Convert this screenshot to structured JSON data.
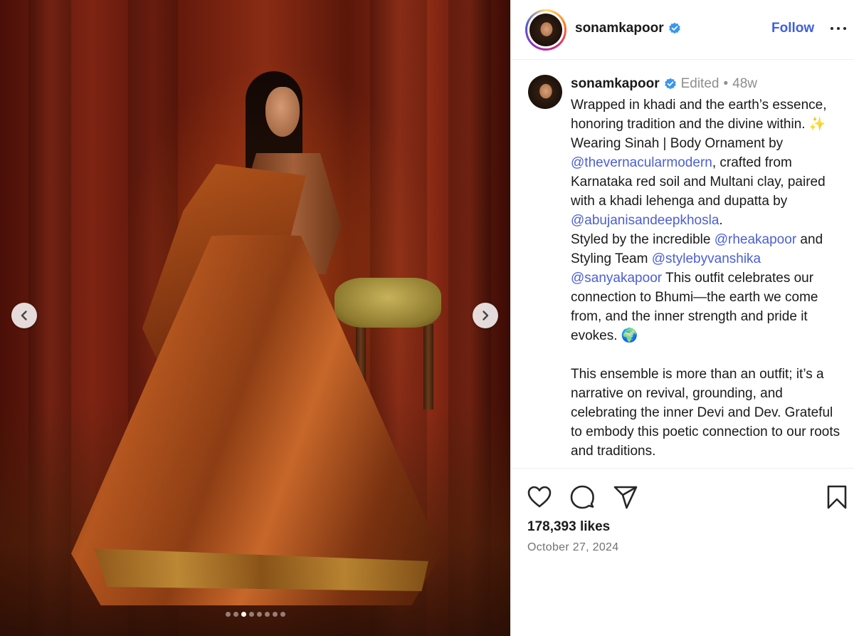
{
  "post": {
    "username": "sonamkapoor",
    "follow_label": "Follow",
    "meta_edited": "Edited",
    "meta_separator": "•",
    "meta_age": "48w",
    "caption": {
      "line1": "Wrapped in khadi and the earth’s essence, honoring tradition and the divine within. ✨",
      "l2_pre": "Wearing Sinah | Body Ornament by ",
      "mention1": "@thevernacularmodern",
      "l2_mid": ", crafted from Karnataka red soil and Multani clay, paired with a khadi lehenga and dupatta by ",
      "mention2": "@abujanisandeepkhosla",
      "l2_post": ".",
      "l3_pre": "Styled by the incredible ",
      "mention3": "@rheakapoor",
      "l3_mid": " and Styling Team ",
      "mention4": "@stylebyvanshika",
      "l3_space": " ",
      "mention5": "@sanyakapoor",
      "l3_post": " This outfit celebrates our connection to Bhumi—the earth we come from, and the inner strength and pride it evokes. 🌍",
      "para2": "This ensemble is more than an outfit; it’s a narrative on revival, grounding, and celebrating the inner Devi and Dev. Grateful to embody this poetic connection to our roots and traditions."
    },
    "likes": "178,393 likes",
    "date": "October 27, 2024",
    "carousel": {
      "count": 8,
      "active_index": 2
    }
  },
  "icons": {
    "verified": "verified-badge-icon",
    "more": "more-options-icon",
    "like": "heart-icon",
    "comment": "comment-icon",
    "share": "share-icon",
    "save": "bookmark-icon",
    "prev": "chevron-left-icon",
    "next": "chevron-right-icon"
  },
  "colors": {
    "accent": "#3f5fe0",
    "mention": "#4b5fd6",
    "verified": "#3897f0"
  }
}
